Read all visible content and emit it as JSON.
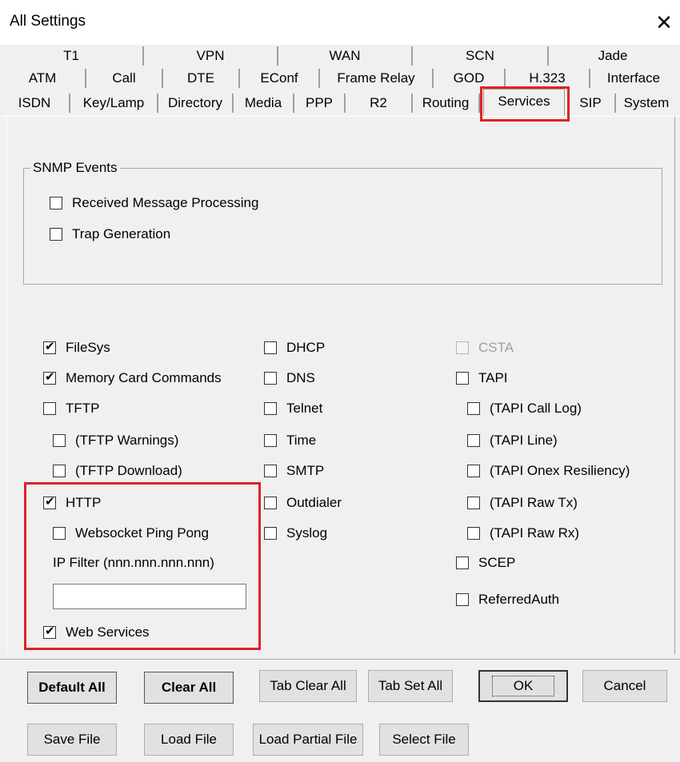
{
  "window": {
    "title": "All Settings",
    "close_glyph": "✕"
  },
  "tabs": {
    "row1": [
      "T1",
      "VPN",
      "WAN",
      "SCN",
      "Jade"
    ],
    "row2": [
      "ATM",
      "Call",
      "DTE",
      "EConf",
      "Frame Relay",
      "GOD",
      "H.323",
      "Interface"
    ],
    "row3": [
      "ISDN",
      "Key/Lamp",
      "Directory",
      "Media",
      "PPP",
      "R2",
      "Routing",
      "Services",
      "SIP",
      "System"
    ],
    "selected": "Services"
  },
  "snmp": {
    "group_label": "SNMP Events",
    "received": {
      "label": "Received Message Processing",
      "checked": false
    },
    "trap": {
      "label": "Trap Generation",
      "checked": false
    }
  },
  "col1": {
    "filesys": {
      "label": "FileSys",
      "checked": true
    },
    "memcard": {
      "label": "Memory Card Commands",
      "checked": true
    },
    "tftp": {
      "label": "TFTP",
      "checked": false
    },
    "tftp_warn": {
      "label": "(TFTP Warnings)",
      "checked": false
    },
    "tftp_dl": {
      "label": "(TFTP Download)",
      "checked": false
    },
    "http": {
      "label": "HTTP",
      "checked": true
    },
    "ws_ping": {
      "label": "Websocket Ping Pong",
      "checked": false
    },
    "ip_filter_label": "IP Filter (nnn.nnn.nnn.nnn)",
    "ip_filter_value": "",
    "web_services": {
      "label": "Web Services",
      "checked": true
    }
  },
  "col2": {
    "dhcp": {
      "label": "DHCP",
      "checked": false
    },
    "dns": {
      "label": "DNS",
      "checked": false
    },
    "telnet": {
      "label": "Telnet",
      "checked": false
    },
    "time": {
      "label": "Time",
      "checked": false
    },
    "smtp": {
      "label": "SMTP",
      "checked": false
    },
    "outdialer": {
      "label": "Outdialer",
      "checked": false
    },
    "syslog": {
      "label": "Syslog",
      "checked": false
    }
  },
  "col3": {
    "csta": {
      "label": "CSTA",
      "checked": false,
      "disabled": true
    },
    "tapi": {
      "label": "TAPI",
      "checked": false
    },
    "tapi_calllog": {
      "label": "(TAPI Call Log)",
      "checked": false
    },
    "tapi_line": {
      "label": "(TAPI Line)",
      "checked": false
    },
    "tapi_onex": {
      "label": "(TAPI Onex Resiliency)",
      "checked": false
    },
    "tapi_rawtx": {
      "label": "(TAPI Raw Tx)",
      "checked": false
    },
    "tapi_rawrx": {
      "label": "(TAPI Raw Rx)",
      "checked": false
    },
    "scep": {
      "label": "SCEP",
      "checked": false
    },
    "referredauth": {
      "label": "ReferredAuth",
      "checked": false
    }
  },
  "buttons": {
    "default_all": "Default All",
    "clear_all": "Clear All",
    "tab_clear_all": "Tab Clear All",
    "tab_set_all": "Tab Set All",
    "ok": "OK",
    "cancel": "Cancel",
    "save_file": "Save File",
    "load_file": "Load File",
    "load_partial_file": "Load Partial File",
    "select_file": "Select File"
  },
  "colors": {
    "highlight": "#e0202a"
  }
}
